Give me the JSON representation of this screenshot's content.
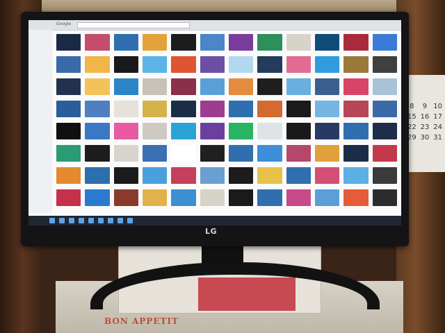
{
  "monitor": {
    "brand": "LG"
  },
  "browser": {
    "logo_text": "Google"
  },
  "calendar": {
    "days": [
      "8",
      "9",
      "10",
      "15",
      "16",
      "17",
      "22",
      "23",
      "24",
      "29",
      "30",
      "31"
    ]
  },
  "box": {
    "printed_text": "BON APPETIT"
  },
  "image_results": {
    "thumbnail_colors": [
      "#1b2a44",
      "#c44d6e",
      "#2f6fb0",
      "#e3a23a",
      "#1c1c1c",
      "#4a86c8",
      "#7a3c9c",
      "#2d8f5a",
      "#d8d3c9",
      "#0f4c7a",
      "#aa2a3a",
      "#3b7bd8",
      "#3a6aa8",
      "#f0b64a",
      "#1a1a1a",
      "#5cb3e6",
      "#dd5533",
      "#6c4fa3",
      "#b1d8ef",
      "#243b5c",
      "#e26b93",
      "#2f9cde",
      "#9a7a3a",
      "#3f3f3f",
      "#22314d",
      "#f4c25b",
      "#2c85c4",
      "#c7c1b7",
      "#8b2f4a",
      "#5aa0d8",
      "#e48c3e",
      "#1e1e1e",
      "#6ab0de",
      "#3a5f8f",
      "#d94466",
      "#a8c3d8",
      "#2a5d9c",
      "#4e7fc0",
      "#e6e2d9",
      "#d6b24a",
      "#1b2c46",
      "#9d3d8d",
      "#2f6fb0",
      "#d46b2e",
      "#1a1a1a",
      "#73b5e3",
      "#b84658",
      "#3d6aa6",
      "#101010",
      "#3a78c6",
      "#e85aa1",
      "#cfcac1",
      "#2aa3d6",
      "#6b3fa0",
      "#28b463",
      "#dfe2e6",
      "#191919",
      "#263a64",
      "#2f6fb0",
      "#1e2d4a",
      "#2b9b73",
      "#1d1d1d",
      "#d9d4cb",
      "#3b6fb2",
      "#ffffff",
      "#202020",
      "#2f6fb0",
      "#3d8fd9",
      "#b5476b",
      "#e2a03a",
      "#1b2c46",
      "#c23a4a",
      "#e58a2f",
      "#2c6fae",
      "#1b1b1b",
      "#4aa0dd",
      "#c53f5e",
      "#6a9fd1",
      "#1c1c1c",
      "#e7c24b",
      "#2f6fb0",
      "#d44f73",
      "#5bb0e5",
      "#3a3a3a",
      "#c5304a",
      "#2a7bd0",
      "#8a3a2a",
      "#e1b24a",
      "#3c8fd0",
      "#d8d3c9",
      "#1a1a1a",
      "#2f6fb0",
      "#c74a8a",
      "#5a9fd8",
      "#e65c3a",
      "#2c2c2c"
    ]
  }
}
